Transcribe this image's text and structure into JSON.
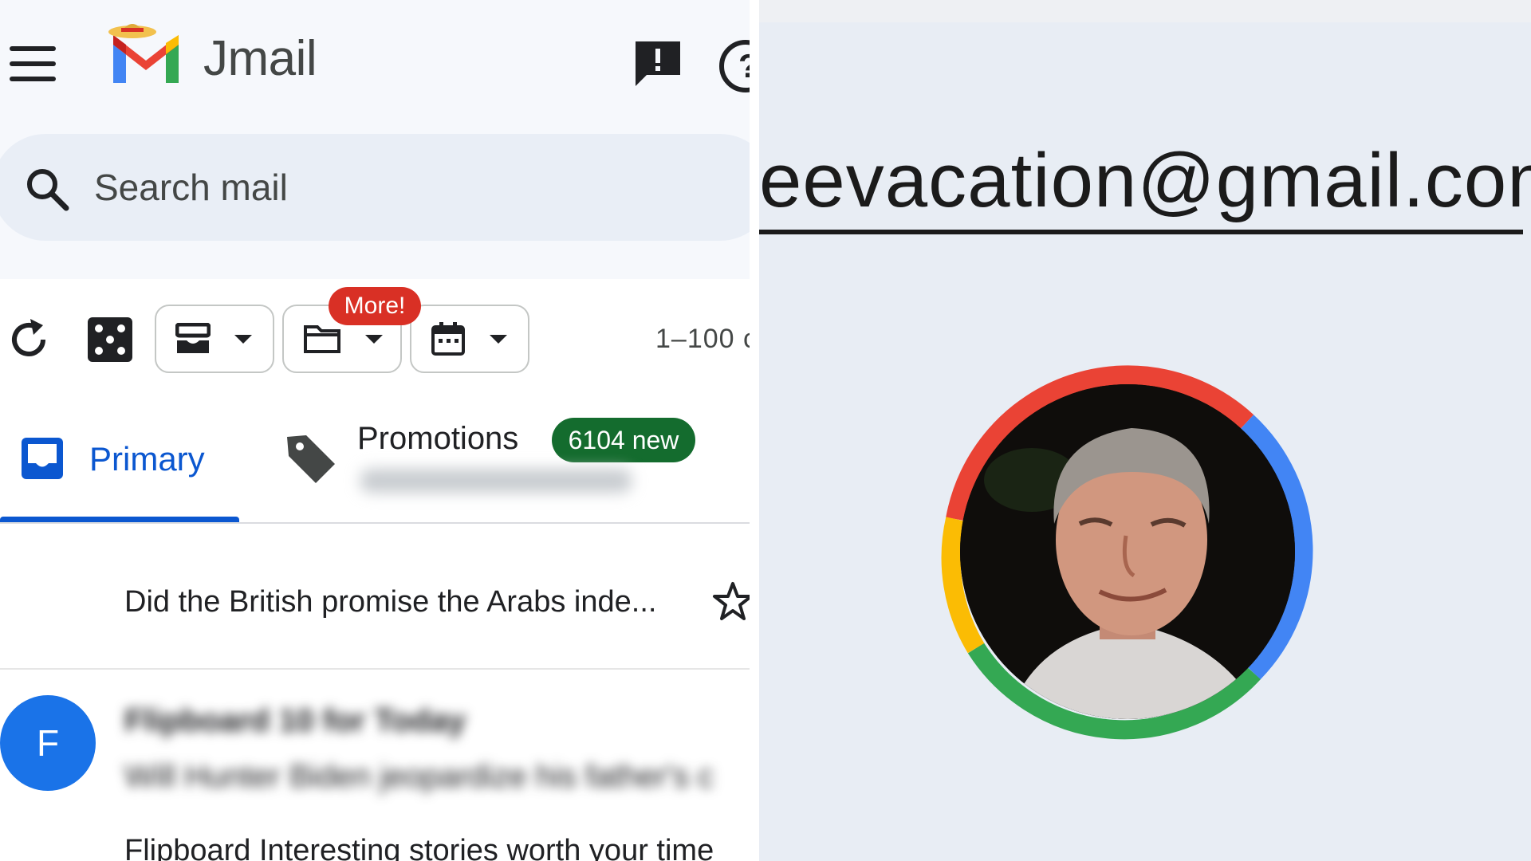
{
  "app": {
    "title": "Jmail",
    "logo_icon": "mail-logo-icon"
  },
  "header": {
    "feedback_icon": "feedback-icon",
    "help_icon": "help-icon",
    "help_glyph": "?"
  },
  "search": {
    "placeholder": "Search mail"
  },
  "toolbar": {
    "more_badge": "More!",
    "page_range": "1–100 c",
    "buttons": [
      "archive-dropdown",
      "folder-dropdown",
      "calendar-dropdown"
    ]
  },
  "tabs": {
    "primary": "Primary",
    "promotions": "Promotions",
    "promotions_badge": "6104 new"
  },
  "messages": [
    {
      "subject": "Did the British promise the Arabs inde..."
    },
    {
      "avatar_letter": "F",
      "sender": "Flipboard 10 for Today",
      "subject": "Will Hunter Biden jeopardize his father's c",
      "snippet": "Flipboard Interesting stories worth your time"
    }
  ],
  "account": {
    "email": "eevacation@gmail.com"
  },
  "colors": {
    "google_red": "#ea4335",
    "google_blue": "#4285f4",
    "google_yellow": "#fbbc04",
    "google_green": "#34a853",
    "primary_blue": "#0b57d0",
    "badge_green": "#146c2e",
    "badge_red": "#d93025"
  }
}
